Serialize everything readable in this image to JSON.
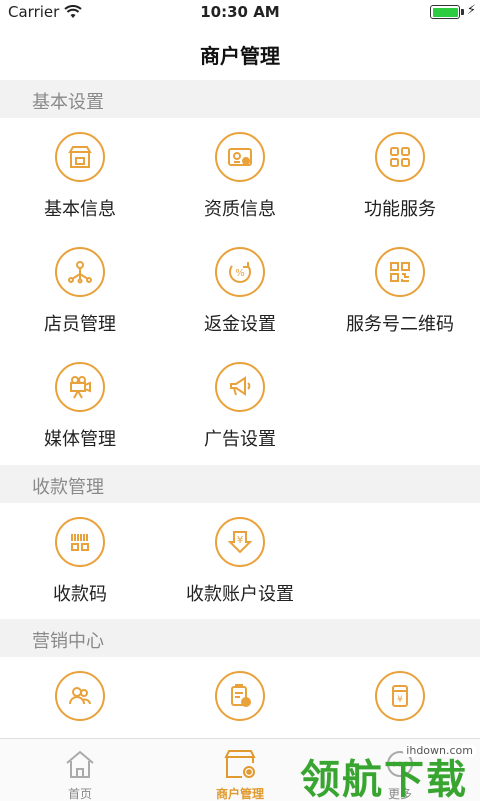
{
  "status_bar": {
    "carrier": "Carrier",
    "time": "10:30 AM"
  },
  "nav": {
    "title": "商户管理"
  },
  "sections": {
    "basic": {
      "title": "基本设置",
      "items": [
        {
          "label": "基本信息",
          "icon": "store-icon"
        },
        {
          "label": "资质信息",
          "icon": "certificate-icon"
        },
        {
          "label": "功能服务",
          "icon": "grid-icon"
        },
        {
          "label": "店员管理",
          "icon": "staff-tree-icon"
        },
        {
          "label": "返金设置",
          "icon": "cashback-icon"
        },
        {
          "label": "服务号二维码",
          "icon": "qrcode-icon"
        },
        {
          "label": "媒体管理",
          "icon": "camera-icon"
        },
        {
          "label": "广告设置",
          "icon": "megaphone-icon"
        }
      ]
    },
    "payment": {
      "title": "收款管理",
      "items": [
        {
          "label": "收款码",
          "icon": "barcode-icon"
        },
        {
          "label": "收款账户设置",
          "icon": "yuan-download-icon"
        }
      ]
    },
    "marketing": {
      "title": "营销中心",
      "items": [
        {
          "label": "",
          "icon": "members-icon"
        },
        {
          "label": "",
          "icon": "clipboard-icon"
        },
        {
          "label": "",
          "icon": "coupon-icon"
        }
      ]
    }
  },
  "tabs": [
    {
      "label": "首页",
      "icon": "home-icon",
      "active": false
    },
    {
      "label": "商户管理",
      "icon": "shop-settings-icon",
      "active": true
    },
    {
      "label": "更多",
      "icon": "more-icon",
      "active": false
    }
  ],
  "watermark": {
    "url": "ihdown.com",
    "logo": "领航下载"
  },
  "colors": {
    "accent": "#e9a23b",
    "section_bg": "#f2f2f2",
    "watermark": "#37a52f"
  }
}
